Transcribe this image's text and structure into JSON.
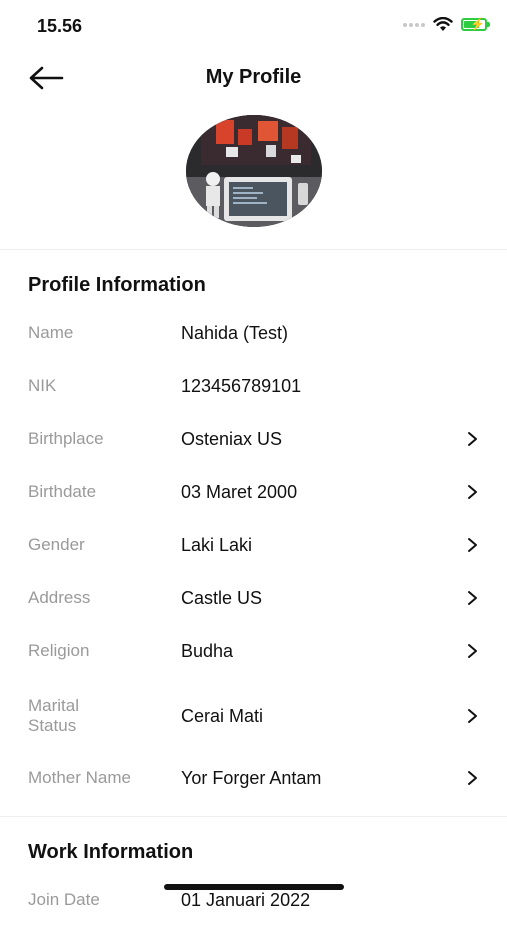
{
  "status": {
    "time": "15.56"
  },
  "header": {
    "title": "My Profile"
  },
  "profile_section": {
    "title": "Profile Information",
    "rows": [
      {
        "label": "Name",
        "value": "Nahida (Test)"
      },
      {
        "label": "NIK",
        "value": "123456789101"
      },
      {
        "label": "Birthplace",
        "value": "Osteniax US"
      },
      {
        "label": "Birthdate",
        "value": "03 Maret 2000"
      },
      {
        "label": "Gender",
        "value": "Laki Laki"
      },
      {
        "label": "Address",
        "value": "Castle US"
      },
      {
        "label": "Religion",
        "value": "Budha"
      },
      {
        "label": "Marital Status",
        "value": "Cerai Mati"
      },
      {
        "label": "Mother Name",
        "value": "Yor Forger Antam"
      }
    ]
  },
  "work_section": {
    "title": "Work Information",
    "rows": [
      {
        "label": "Join Date",
        "value": "01 Januari 2022"
      }
    ]
  },
  "icons": {
    "back": "arrow-left-icon",
    "chevron": "chevron-right-icon",
    "wifi": "wifi-icon",
    "battery": "battery-charging-icon"
  },
  "colors": {
    "label": "#9a9a9a",
    "value": "#111111",
    "battery": "#2ecc40",
    "divider": "#eeeeee"
  }
}
